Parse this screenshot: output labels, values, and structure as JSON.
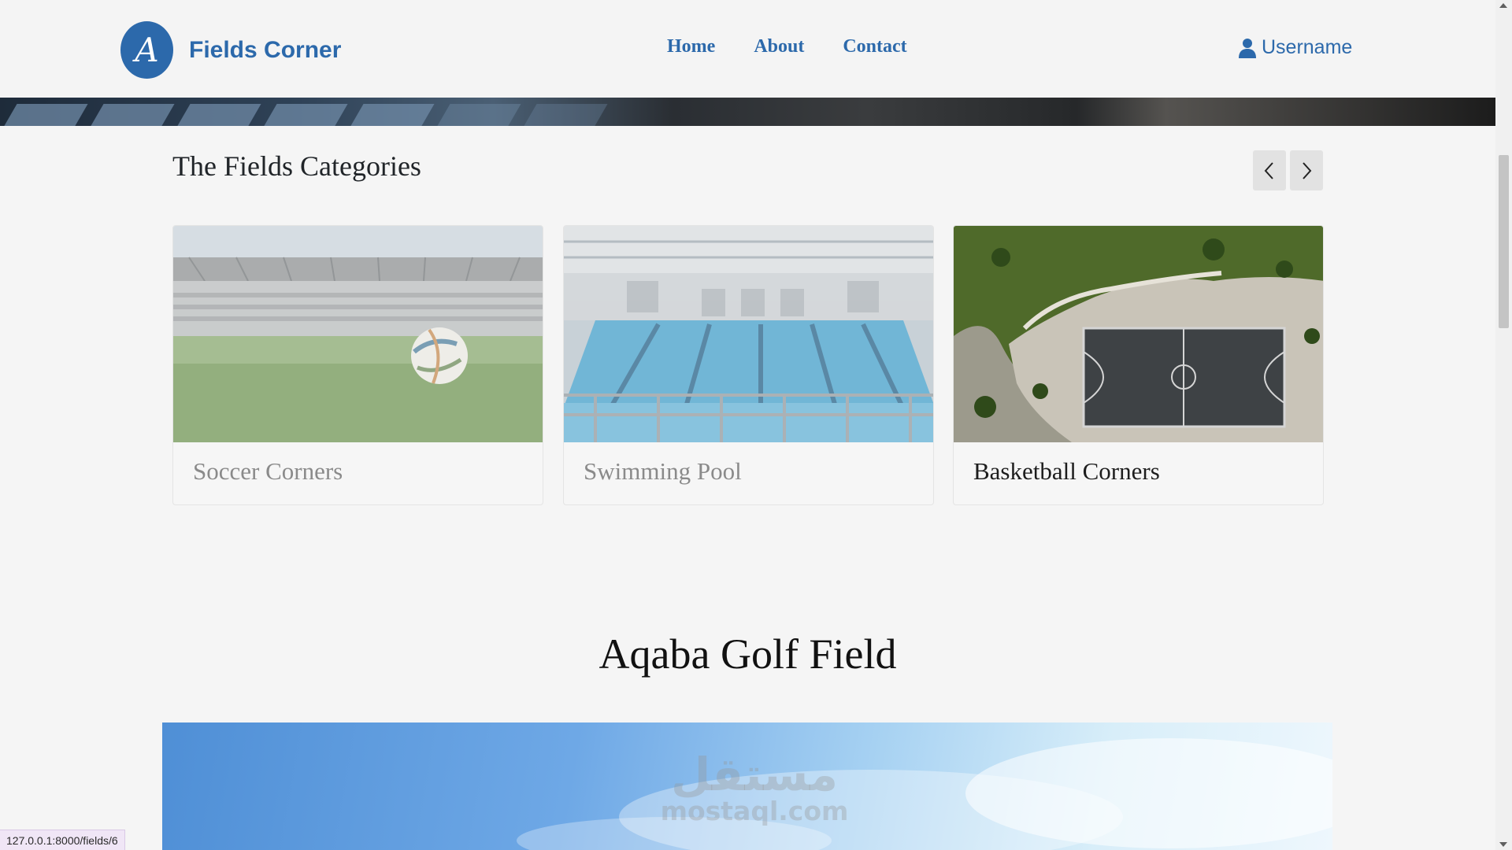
{
  "header": {
    "logo_letter": "A",
    "brand_name": "Fields Corner",
    "nav": [
      "Home",
      "About",
      "Contact"
    ],
    "username": "Username"
  },
  "categories": {
    "title": "The Fields Categories",
    "items": [
      {
        "label": "Soccer Corners",
        "faded": true
      },
      {
        "label": "Swimming Pool",
        "faded": true
      },
      {
        "label": "Basketball Corners",
        "faded": false
      }
    ]
  },
  "featured": {
    "title": "Aqaba Golf Field"
  },
  "watermark": {
    "arabic": "مستقل",
    "latin": "mostaql.com"
  },
  "status_bar": {
    "url": "127.0.0.1:8000/fields/6"
  },
  "colors": {
    "brand": "#2c69ab",
    "background": "#f5f5f5"
  }
}
